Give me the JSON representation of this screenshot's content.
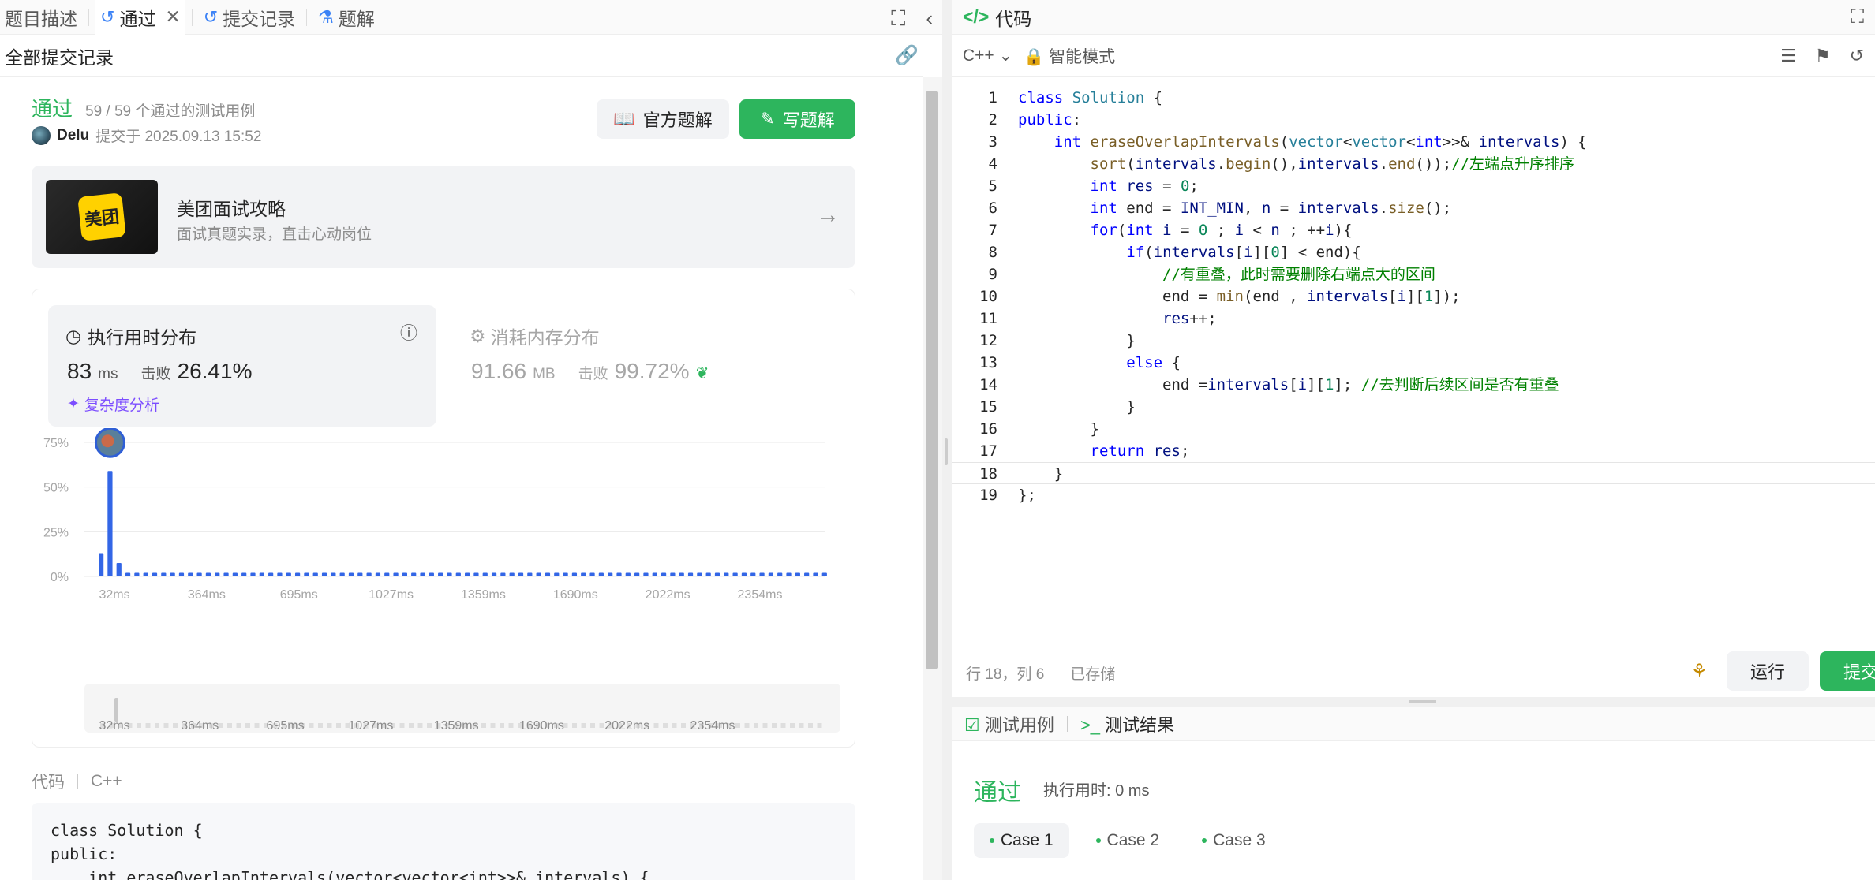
{
  "left_tabs": [
    {
      "label": "题目描述",
      "icon": ""
    },
    {
      "label": "通过",
      "icon": "history-icon"
    },
    {
      "label": "提交记录",
      "icon": "history-icon"
    },
    {
      "label": "题解",
      "icon": "flask-icon"
    }
  ],
  "subbar": {
    "title": "全部提交记录"
  },
  "submission": {
    "status": "通过",
    "cases": "59 / 59 个通过的测试用例",
    "user": "Delu",
    "submitted_at": "提交于 2025.09.13 15:52",
    "official_solution_label": "官方题解",
    "write_solution_label": "写题解"
  },
  "banner": {
    "logo_text": "美团",
    "title": "美团面试攻略",
    "subtitle": "面试真题实录，直击心动岗位"
  },
  "runtime": {
    "title": "执行用时分布",
    "value": "83",
    "unit": "ms",
    "beat_label": "击败",
    "beat_value": "26.41%",
    "complexity_label": "复杂度分析"
  },
  "memory": {
    "title": "消耗内存分布",
    "value": "91.66",
    "unit": "MB",
    "beat_label": "击败",
    "beat_value": "99.72%"
  },
  "chart_data": {
    "type": "bar",
    "y_ticks": [
      "75%",
      "50%",
      "25%",
      "0%"
    ],
    "ylim": [
      0,
      75
    ],
    "x_ticks": [
      "32ms",
      "364ms",
      "695ms",
      "1027ms",
      "1359ms",
      "1690ms",
      "2022ms",
      "2354ms"
    ],
    "brush_ticks": [
      "32ms",
      "364ms",
      "695ms",
      "1027ms",
      "1359ms",
      "1690ms",
      "2022ms",
      "2354ms"
    ],
    "values": [
      13,
      59,
      7.5,
      2,
      2,
      2,
      2,
      2,
      2,
      2,
      2,
      2,
      2,
      2,
      2,
      2,
      2,
      2,
      2,
      2,
      2,
      2,
      2,
      2,
      2,
      2,
      2,
      2,
      2,
      2,
      2,
      2,
      2,
      2,
      2,
      2,
      2,
      2,
      2,
      2,
      2,
      2,
      2,
      2,
      2,
      2,
      2,
      2,
      2,
      2,
      2,
      2,
      2,
      2,
      2,
      2,
      2,
      2,
      2,
      2,
      2,
      2,
      2,
      2,
      2,
      2,
      2,
      2,
      2,
      2,
      2,
      2,
      2,
      2,
      2,
      2,
      2,
      2,
      2,
      2,
      2,
      2
    ],
    "highlight_index": 1,
    "bar_color": "#3366e6"
  },
  "code_preview": {
    "label": "代码",
    "lang": "C++",
    "lines": [
      "class Solution {",
      "public:",
      "    int eraseOverlapIntervals(vector<vector<int>>& intervals) {"
    ]
  },
  "editor": {
    "title": "代码",
    "language": "C++",
    "mode": "智能模式",
    "status_position": "行 18，列 6",
    "status_saved": "已存储",
    "run_label": "运行",
    "submit_label": "提交",
    "lines": [
      "class Solution {",
      "public:",
      "    int eraseOverlapIntervals(vector<vector<int>>& intervals) {",
      "        sort(intervals.begin(),intervals.end());//左端点升序排序",
      "        int res = 0;",
      "        int end = INT_MIN, n = intervals.size();",
      "        for(int i = 0 ; i < n ; ++i){",
      "            if(intervals[i][0] < end){",
      "                //有重叠，此时需要删除右端点大的区间",
      "                end = min(end , intervals[i][1]);",
      "                res++;",
      "            }",
      "            else {",
      "                end =intervals[i][1]; //去判断后续区间是否有重叠",
      "            }",
      "        }",
      "        return res;",
      "    }",
      "};"
    ],
    "current_line": 18
  },
  "results": {
    "tab_cases": "测试用例",
    "tab_result": "测试结果",
    "status": "通过",
    "runtime": "执行用时: 0 ms",
    "cases": [
      "Case 1",
      "Case 2",
      "Case 3"
    ]
  },
  "colors": {
    "accent": "#2db55d",
    "brand": "#ffd100",
    "link": "#3b82f6"
  }
}
